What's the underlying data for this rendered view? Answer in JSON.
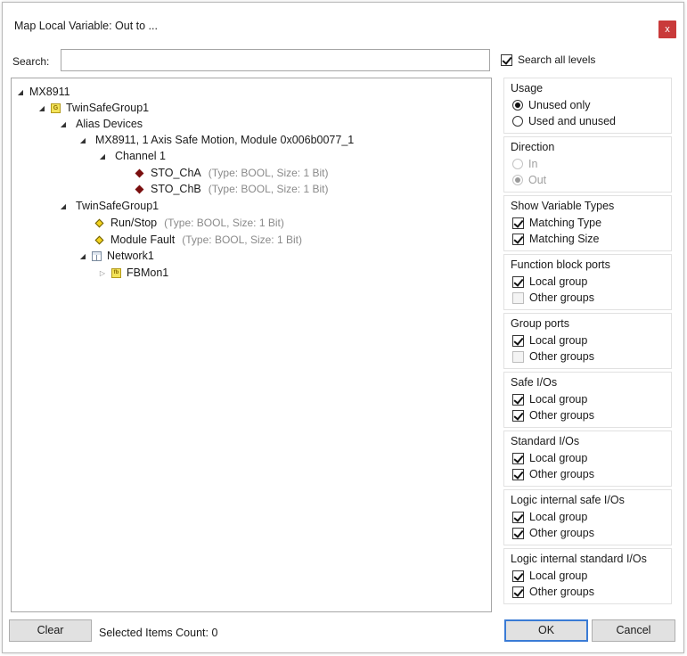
{
  "window": {
    "title": "Map Local Variable: Out to ...",
    "close_glyph": "x"
  },
  "search": {
    "label": "Search:",
    "value": "",
    "placeholder": "",
    "all_levels_label": "Search all levels",
    "all_levels_checked": true
  },
  "tree": {
    "nodes": [
      {
        "label": "MX8911",
        "expander": "expanded",
        "icon": "none"
      },
      {
        "label": "TwinSafeGroup1",
        "expander": "expanded",
        "icon": "group-icon",
        "icon_text": "G"
      },
      {
        "label": "Alias Devices",
        "expander": "expanded",
        "icon": "none"
      },
      {
        "label": "MX8911, 1 Axis Safe Motion, Module 0x006b0077_1",
        "expander": "expanded",
        "icon": "none"
      },
      {
        "label": "Channel 1",
        "expander": "expanded",
        "icon": "none"
      },
      {
        "label": "STO_ChA",
        "type": "(Type: BOOL, Size: 1 Bit)",
        "icon": "red-diamond-icon"
      },
      {
        "label": "STO_ChB",
        "type": "(Type: BOOL, Size: 1 Bit)",
        "icon": "red-diamond-icon"
      },
      {
        "label": "TwinSafeGroup1",
        "expander": "expanded",
        "icon": "none"
      },
      {
        "label": "Run/Stop",
        "type": "(Type: BOOL, Size: 1 Bit)",
        "icon": "yellow-diamond-icon"
      },
      {
        "label": "Module Fault",
        "type": "(Type: BOOL, Size: 1 Bit)",
        "icon": "yellow-diamond-icon"
      },
      {
        "label": "Network1",
        "expander": "expanded",
        "icon": "network-icon"
      },
      {
        "label": "FBMon1",
        "expander": "collapsed",
        "icon": "function-block-icon",
        "icon_text": "fb"
      }
    ]
  },
  "panel": {
    "usage": {
      "title": "Usage",
      "options": [
        {
          "label": "Unused only",
          "selected": true
        },
        {
          "label": "Used and unused",
          "selected": false
        }
      ]
    },
    "direction": {
      "title": "Direction",
      "options": [
        {
          "label": "In",
          "selected": false,
          "disabled": true
        },
        {
          "label": "Out",
          "selected": true,
          "disabled": true
        }
      ]
    },
    "variable_types": {
      "title": "Show Variable Types",
      "options": [
        {
          "label": "Matching Type",
          "checked": true
        },
        {
          "label": "Matching Size",
          "checked": true
        }
      ]
    },
    "function_block_ports": {
      "title": "Function block ports",
      "options": [
        {
          "label": "Local group",
          "checked": true
        },
        {
          "label": "Other groups",
          "checked": false,
          "disabled": true
        }
      ]
    },
    "group_ports": {
      "title": "Group ports",
      "options": [
        {
          "label": "Local group",
          "checked": true
        },
        {
          "label": "Other groups",
          "checked": false,
          "disabled": true
        }
      ]
    },
    "safe_ios": {
      "title": "Safe I/Os",
      "options": [
        {
          "label": "Local group",
          "checked": true
        },
        {
          "label": "Other groups",
          "checked": true
        }
      ]
    },
    "standard_ios": {
      "title": "Standard I/Os",
      "options": [
        {
          "label": "Local group",
          "checked": true
        },
        {
          "label": "Other groups",
          "checked": true
        }
      ]
    },
    "logic_internal_safe_ios": {
      "title": "Logic internal safe I/Os",
      "options": [
        {
          "label": "Local group",
          "checked": true
        },
        {
          "label": "Other groups",
          "checked": true
        }
      ]
    },
    "logic_internal_standard_ios": {
      "title": "Logic internal standard I/Os",
      "options": [
        {
          "label": "Local group",
          "checked": true
        },
        {
          "label": "Other groups",
          "checked": true
        }
      ]
    }
  },
  "footer": {
    "clear_label": "Clear",
    "selected_count_text": "Selected Items Count: 0",
    "ok_label": "OK",
    "cancel_label": "Cancel"
  },
  "colors": {
    "close_button": "#c93a3a",
    "default_button_border": "#3a7bd5",
    "dialog_background": "#ffffff",
    "button_face": "#e1e1e1"
  }
}
